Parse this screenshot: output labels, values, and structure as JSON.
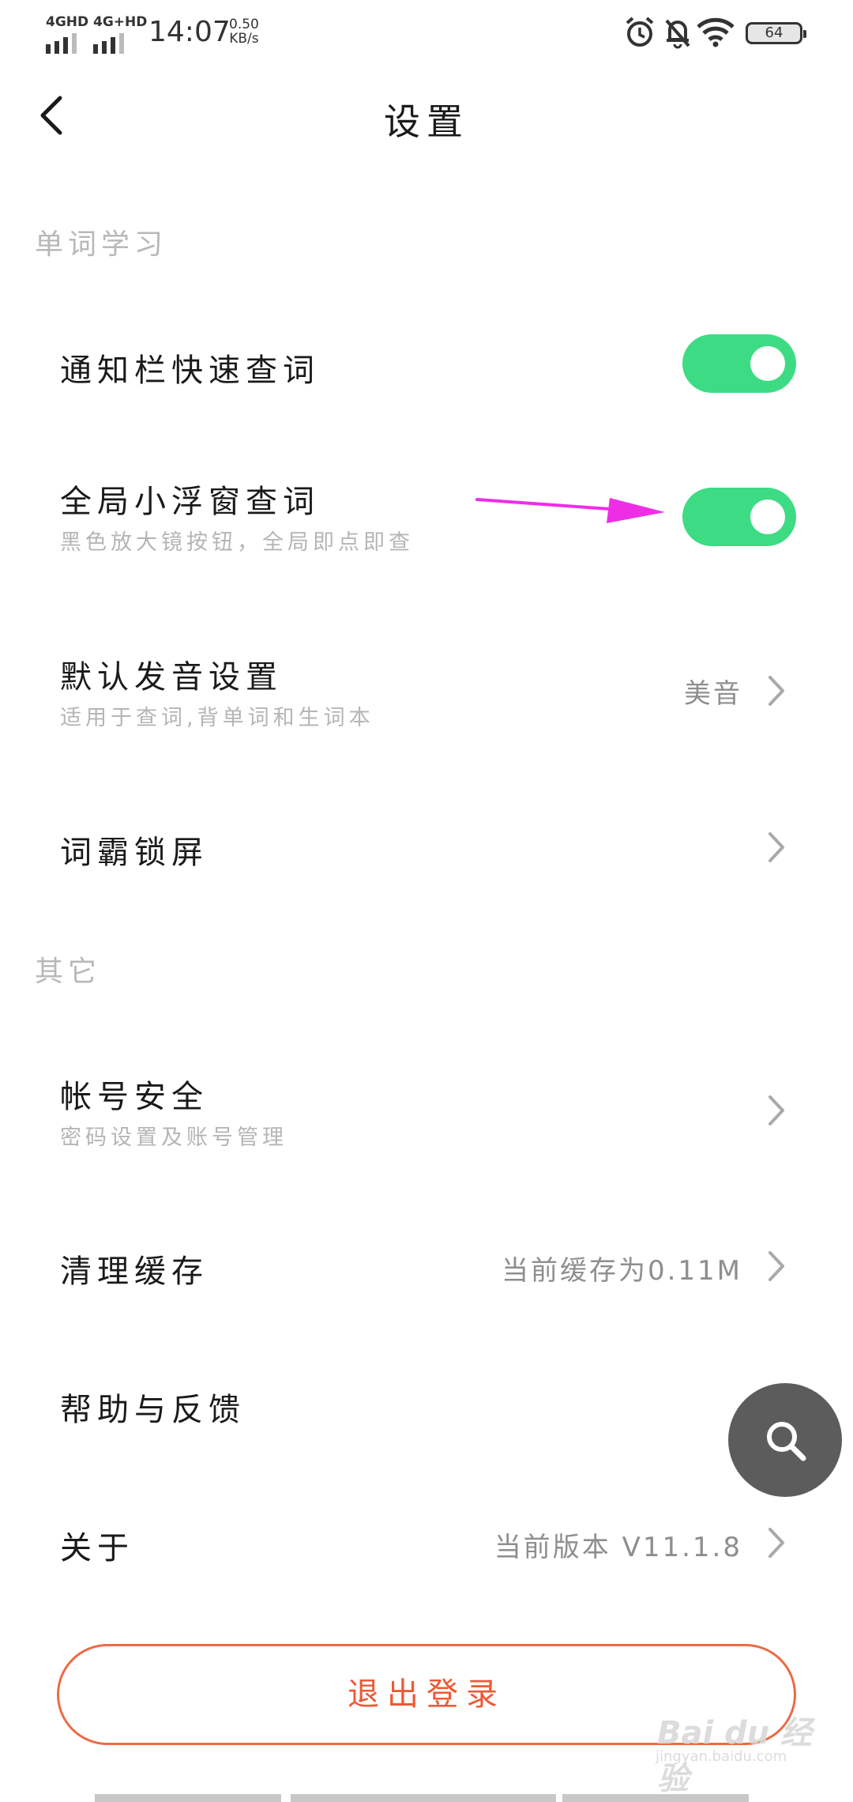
{
  "status_bar": {
    "network_1": "4GHD",
    "network_2": "4G+HD",
    "time": "14:07",
    "speed_value": "0.50",
    "speed_unit": "KB/s",
    "battery": "64",
    "icons": [
      "alarm-icon",
      "bell-off-icon",
      "wifi-icon",
      "battery-icon"
    ]
  },
  "header": {
    "title": "设置",
    "back_icon": "chevron-left-icon"
  },
  "sections": {
    "word_learning": "单词学习",
    "other": "其它"
  },
  "settings": {
    "notify_lookup": {
      "title": "通知栏快速查词",
      "enabled": true
    },
    "float_lookup": {
      "title": "全局小浮窗查词",
      "subtitle": "黑色放大镜按钮，全局即点即查",
      "enabled": true
    },
    "pronunciation": {
      "title": "默认发音设置",
      "subtitle": "适用于查词,背单词和生词本",
      "value": "美音"
    },
    "lock_screen": {
      "title": "词霸锁屏"
    },
    "account": {
      "title": "帐号安全",
      "subtitle": "密码设置及账号管理"
    },
    "cache": {
      "title": "清理缓存",
      "value": "当前缓存为0.11M"
    },
    "help": {
      "title": "帮助与反馈"
    },
    "about": {
      "title": "关于",
      "value": "当前版本 V11.1.8"
    }
  },
  "fab": {
    "icon": "search-icon"
  },
  "logout": {
    "label": "退出登录"
  },
  "colors": {
    "toggle_on": "#3ddc84",
    "accent": "#ec5a35",
    "arrow": "#ee2ee6",
    "fab": "#5c5c5c"
  },
  "watermark": {
    "brand": "Bai du 经验",
    "domain": "jingyan.baidu.com"
  }
}
